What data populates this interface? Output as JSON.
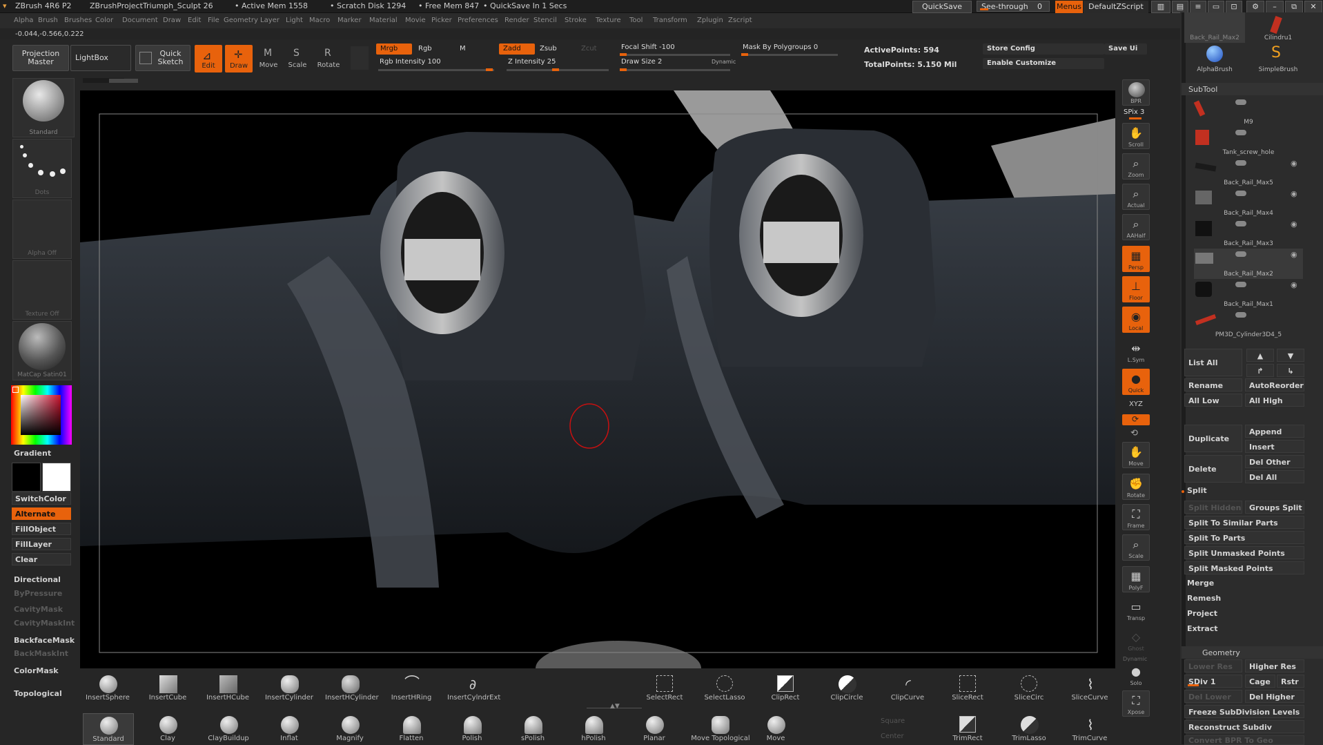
{
  "titlebar": {
    "app": "ZBrush 4R6 P2",
    "project": "ZBrushProjectTriumph_Sculpt 26",
    "active_mem": "• Active Mem 1558",
    "scratch": "• Scratch Disk 1294",
    "free_mem": "• Free Mem 847",
    "quicksave_timer": "• QuickSave In 1 Secs",
    "quicksave_btn": "QuickSave",
    "see_through": "See-through",
    "see_through_val": "0",
    "menus_btn": "Menus",
    "default_zscript": "DefaultZScript"
  },
  "menubar": [
    "Alpha",
    "Brush",
    "Brushes",
    "Color",
    "Document",
    "Draw",
    "Edit",
    "File",
    "Geometry",
    "Layer",
    "Light",
    "Macro",
    "Marker",
    "Material",
    "Movie",
    "Picker",
    "Preferences",
    "Render",
    "Stencil",
    "Stroke",
    "Texture",
    "Tool",
    "Transform",
    "Zplugin",
    "Zscript"
  ],
  "coords": "-0.044,-0.566,0.222",
  "shelf": {
    "projection_master": "Projection Master",
    "lightbox": "LightBox",
    "quick_sketch": "Quick Sketch",
    "edit": "Edit",
    "draw": "Draw",
    "move": "Move",
    "scale": "Scale",
    "rotate": "Rotate",
    "mrgb": "Mrgb",
    "rgb": "Rgb",
    "m": "M",
    "zadd": "Zadd",
    "zsub": "Zsub",
    "zcut": "Zcut",
    "rgb_intensity": "Rgb Intensity 100",
    "z_intensity": "Z Intensity 25",
    "focal_shift": "Focal Shift -100",
    "draw_size": "Draw Size 2",
    "dynamic": "Dynamic",
    "mask_by_polygroups": "Mask By Polygroups 0",
    "active_points": "ActivePoints: 594",
    "total_points": "TotalPoints: 5.150 Mil",
    "store_config": "Store Config",
    "enable_customize": "Enable Customize",
    "save_ui": "Save Ui"
  },
  "leftpanel": {
    "brush": "Standard",
    "stroke": "Dots",
    "alpha": "Alpha Off",
    "texture": "Texture Off",
    "material": "MatCap Satin01",
    "gradient": "Gradient",
    "switchcolor": "SwitchColor",
    "alternate": "Alternate",
    "fillobject": "FillObject",
    "filllayer": "FillLayer",
    "clear": "Clear",
    "directional": "Directional",
    "bypressure": "ByPressure",
    "cavitymask": "CavityMask",
    "cavitymaskint": "CavityMaskInt",
    "backfacemask": "BackfaceMask",
    "backmaskint": "BackMaskInt",
    "colormask": "ColorMask",
    "topological": "Topological"
  },
  "righttoolbar": {
    "bpr": "BPR",
    "spix": "SPix 3",
    "scroll": "Scroll",
    "zoom": "Zoom",
    "actual": "Actual",
    "aahalf": "AAHalf",
    "persp": "Persp",
    "floor": "Floor",
    "local": "Local",
    "lsym": "L.Sym",
    "quick": "Quick",
    "xyz": "XYZ",
    "move": "Move",
    "rotate": "Rotate",
    "frame": "Frame",
    "scale": "Scale",
    "polyf": "PolyF",
    "transp": "Transp",
    "ghost": "Ghost",
    "dynamic": "Dynamic",
    "solo": "Solo",
    "xpose": "Xpose"
  },
  "rightpanel": {
    "top_items": [
      "Back_Rail_Max2",
      "Cilindru1",
      "AlphaBrush",
      "SimpleBrush"
    ],
    "subtool_title": "SubTool",
    "subtools": [
      "M9",
      "Tank_screw_hole",
      "Back_Rail_Max5",
      "Back_Rail_Max4",
      "Back_Rail_Max3",
      "Back_Rail_Max2",
      "Back_Rail_Max1",
      "PM3D_Cylinder3D4_5"
    ],
    "list_all": "List All",
    "rename": "Rename",
    "autoreorder": "AutoReorder",
    "all_low": "All Low",
    "all_high": "All High",
    "duplicate": "Duplicate",
    "append": "Append",
    "insert": "Insert",
    "delete": "Delete",
    "del_other": "Del Other",
    "del_all": "Del All",
    "split": "Split",
    "split_hidden": "Split Hidden",
    "groups_split": "Groups Split",
    "split_similar": "Split To Similar Parts",
    "split_parts": "Split To Parts",
    "split_unmasked": "Split Unmasked Points",
    "split_masked": "Split Masked Points",
    "merge": "Merge",
    "remesh": "Remesh",
    "project": "Project",
    "extract": "Extract",
    "geometry_title": "Geometry",
    "lower_res": "Lower Res",
    "higher_res": "Higher Res",
    "sdiv": "SDiv 1",
    "cage": "Cage",
    "rstr": "Rstr",
    "del_lower": "Del Lower",
    "del_higher": "Del Higher",
    "freeze_subdiv": "Freeze SubDivision Levels",
    "reconstruct_subdiv": "Reconstruct Subdiv",
    "convert_bpr": "Convert BPR To Geo"
  },
  "bottom_row1": [
    "InsertSphere",
    "InsertCube",
    "InsertHCube",
    "InsertCylinder",
    "InsertHCylinder",
    "InsertHRing",
    "InsertCylndrExt"
  ],
  "bottom_row1_right": [
    "SelectRect",
    "SelectLasso",
    "ClipRect",
    "ClipCircle",
    "ClipCurve",
    "SliceRect",
    "SliceCirc",
    "SliceCurve"
  ],
  "bottom_row2": [
    "Standard",
    "Clay",
    "ClayBuildup",
    "Inflat",
    "Magnify",
    "Flatten",
    "Polish",
    "sPolish",
    "hPolish",
    "Planar",
    "Move Topological",
    "Move"
  ],
  "bottom_row2_right": [
    "Square",
    "Center",
    "TrimRect",
    "TrimLasso",
    "TrimCurve"
  ],
  "colors": {
    "accent": "#e8620c",
    "panel": "#2c2c2c",
    "viewport": "#000000"
  }
}
